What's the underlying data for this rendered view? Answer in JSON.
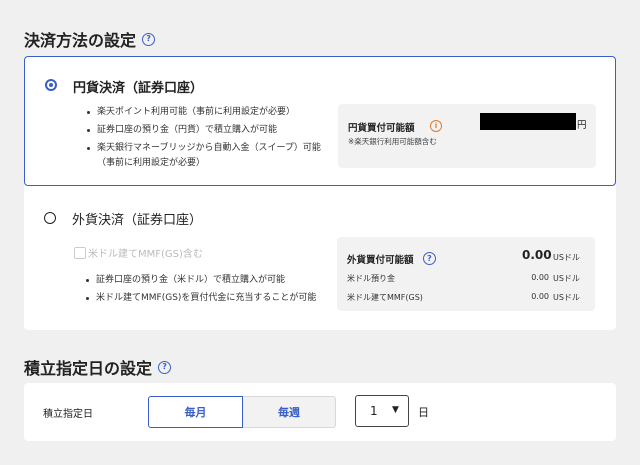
{
  "payment_section": {
    "title": "決済方法の設定",
    "help_icon": "help-circle-icon"
  },
  "yen_option": {
    "title": "円貨決済（証券口座）",
    "selected": true,
    "bullets": [
      "楽天ポイント利用可能（事前に利用設定が必要）",
      "証券口座の預り金（円貨）で積立購入が可能",
      "楽天銀行マネーブリッジから自動入金（スイープ）可能（事前に利用設定が必要）"
    ],
    "panel": {
      "label": "円貨買付可能額",
      "info_icon": "info-icon",
      "unit": "円",
      "note": "※楽天銀行利用可能額含む"
    }
  },
  "foreign_option": {
    "title": "外貨決済（証券口座）",
    "selected": false,
    "checkbox_label": "米ドル建てMMF(GS)含む",
    "bullets": [
      "証券口座の預り金（米ドル）で積立購入が可能",
      "米ドル建てMMF(GS)を買付代金に充当することが可能"
    ],
    "panel": {
      "label": "外貨買付可能額",
      "total_value": "0.00",
      "total_unit": "USドル",
      "rows": [
        {
          "label": "米ドル預り金",
          "value": "0.00",
          "unit": "USドル"
        },
        {
          "label": "米ドル建てMMF(GS)",
          "value": "0.00",
          "unit": "USドル"
        }
      ]
    }
  },
  "schedule_section": {
    "title": "積立指定日の設定",
    "help_icon": "help-circle-icon",
    "field_label": "積立指定日",
    "tabs": [
      {
        "label": "毎月",
        "active": true
      },
      {
        "label": "毎週",
        "active": false
      }
    ],
    "day_value": "1",
    "day_unit": "日"
  },
  "colors": {
    "accent": "#3a5fc8",
    "warning": "#e07b2a"
  }
}
